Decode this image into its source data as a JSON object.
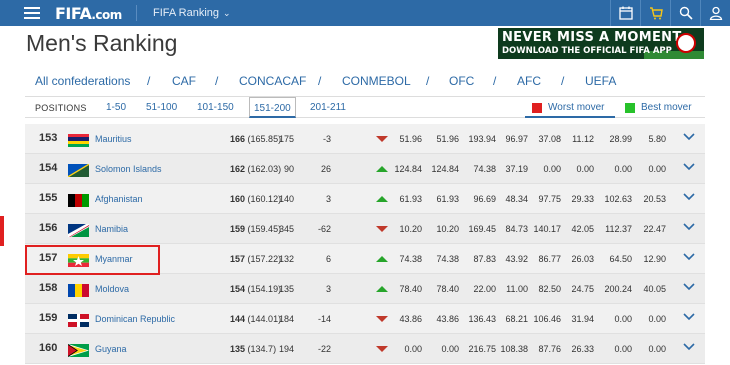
{
  "header": {
    "logo_text": "FIFA",
    "logo_suffix": ".com",
    "section": "FIFA Ranking",
    "icons": [
      "calendar-icon",
      "cart-icon",
      "search-icon",
      "user-icon"
    ]
  },
  "page_title": "Men's Ranking",
  "banner": {
    "line1": "NEVER MISS A MOMENT",
    "line2": "DOWNLOAD THE OFFICIAL FIFA APP"
  },
  "confederations": [
    "All confederations",
    "CAF",
    "CONCACAF",
    "CONMEBOL",
    "OFC",
    "AFC",
    "UEFA"
  ],
  "positions": {
    "label": "POSITIONS",
    "tabs": [
      "1-50",
      "51-100",
      "101-150",
      "151-200",
      "201-211"
    ],
    "active": "151-200"
  },
  "movers": {
    "worst": "Worst mover",
    "best": "Best mover",
    "worst_color": "#e02020",
    "best_color": "#27c22b"
  },
  "rows": [
    {
      "rank": "153",
      "team": "Mauritius",
      "pts": "166",
      "prev": "(165.85)",
      "c1": "175",
      "c2": "-3",
      "dir": "down",
      "v1": "51.96",
      "v2": "51.96",
      "v3": "193.94",
      "v4": "96.97",
      "v5": "37.08",
      "v6": "11.12",
      "v7": "28.99",
      "v8": "5.80"
    },
    {
      "rank": "154",
      "team": "Solomon Islands",
      "pts": "162",
      "prev": "(162.03)",
      "c1": "90",
      "c2": "26",
      "dir": "up",
      "v1": "124.84",
      "v2": "124.84",
      "v3": "74.38",
      "v4": "37.19",
      "v5": "0.00",
      "v6": "0.00",
      "v7": "0.00",
      "v8": "0.00"
    },
    {
      "rank": "155",
      "team": "Afghanistan",
      "pts": "160",
      "prev": "(160.12)",
      "c1": "140",
      "c2": "3",
      "dir": "up",
      "v1": "61.93",
      "v2": "61.93",
      "v3": "96.69",
      "v4": "48.34",
      "v5": "97.75",
      "v6": "29.33",
      "v7": "102.63",
      "v8": "20.53"
    },
    {
      "rank": "156",
      "team": "Namibia",
      "pts": "159",
      "prev": "(159.45)",
      "c1": "345",
      "c2": "-62",
      "dir": "down",
      "v1": "10.20",
      "v2": "10.20",
      "v3": "169.45",
      "v4": "84.73",
      "v5": "140.17",
      "v6": "42.05",
      "v7": "112.37",
      "v8": "22.47"
    },
    {
      "rank": "157",
      "team": "Myanmar",
      "pts": "157",
      "prev": "(157.22)",
      "c1": "132",
      "c2": "6",
      "dir": "up",
      "v1": "74.38",
      "v2": "74.38",
      "v3": "87.83",
      "v4": "43.92",
      "v5": "86.77",
      "v6": "26.03",
      "v7": "64.50",
      "v8": "12.90"
    },
    {
      "rank": "158",
      "team": "Moldova",
      "pts": "154",
      "prev": "(154.19)",
      "c1": "135",
      "c2": "3",
      "dir": "up",
      "v1": "78.40",
      "v2": "78.40",
      "v3": "22.00",
      "v4": "11.00",
      "v5": "82.50",
      "v6": "24.75",
      "v7": "200.24",
      "v8": "40.05"
    },
    {
      "rank": "159",
      "team": "Dominican Republic",
      "pts": "144",
      "prev": "(144.01)",
      "c1": "184",
      "c2": "-14",
      "dir": "down",
      "v1": "43.86",
      "v2": "43.86",
      "v3": "136.43",
      "v4": "68.21",
      "v5": "106.46",
      "v6": "31.94",
      "v7": "0.00",
      "v8": "0.00"
    },
    {
      "rank": "160",
      "team": "Guyana",
      "pts": "135",
      "prev": "(134.7)",
      "c1": "194",
      "c2": "-22",
      "dir": "down",
      "v1": "0.00",
      "v2": "0.00",
      "v3": "216.75",
      "v4": "108.38",
      "v5": "87.76",
      "v6": "26.33",
      "v7": "0.00",
      "v8": "0.00"
    }
  ]
}
